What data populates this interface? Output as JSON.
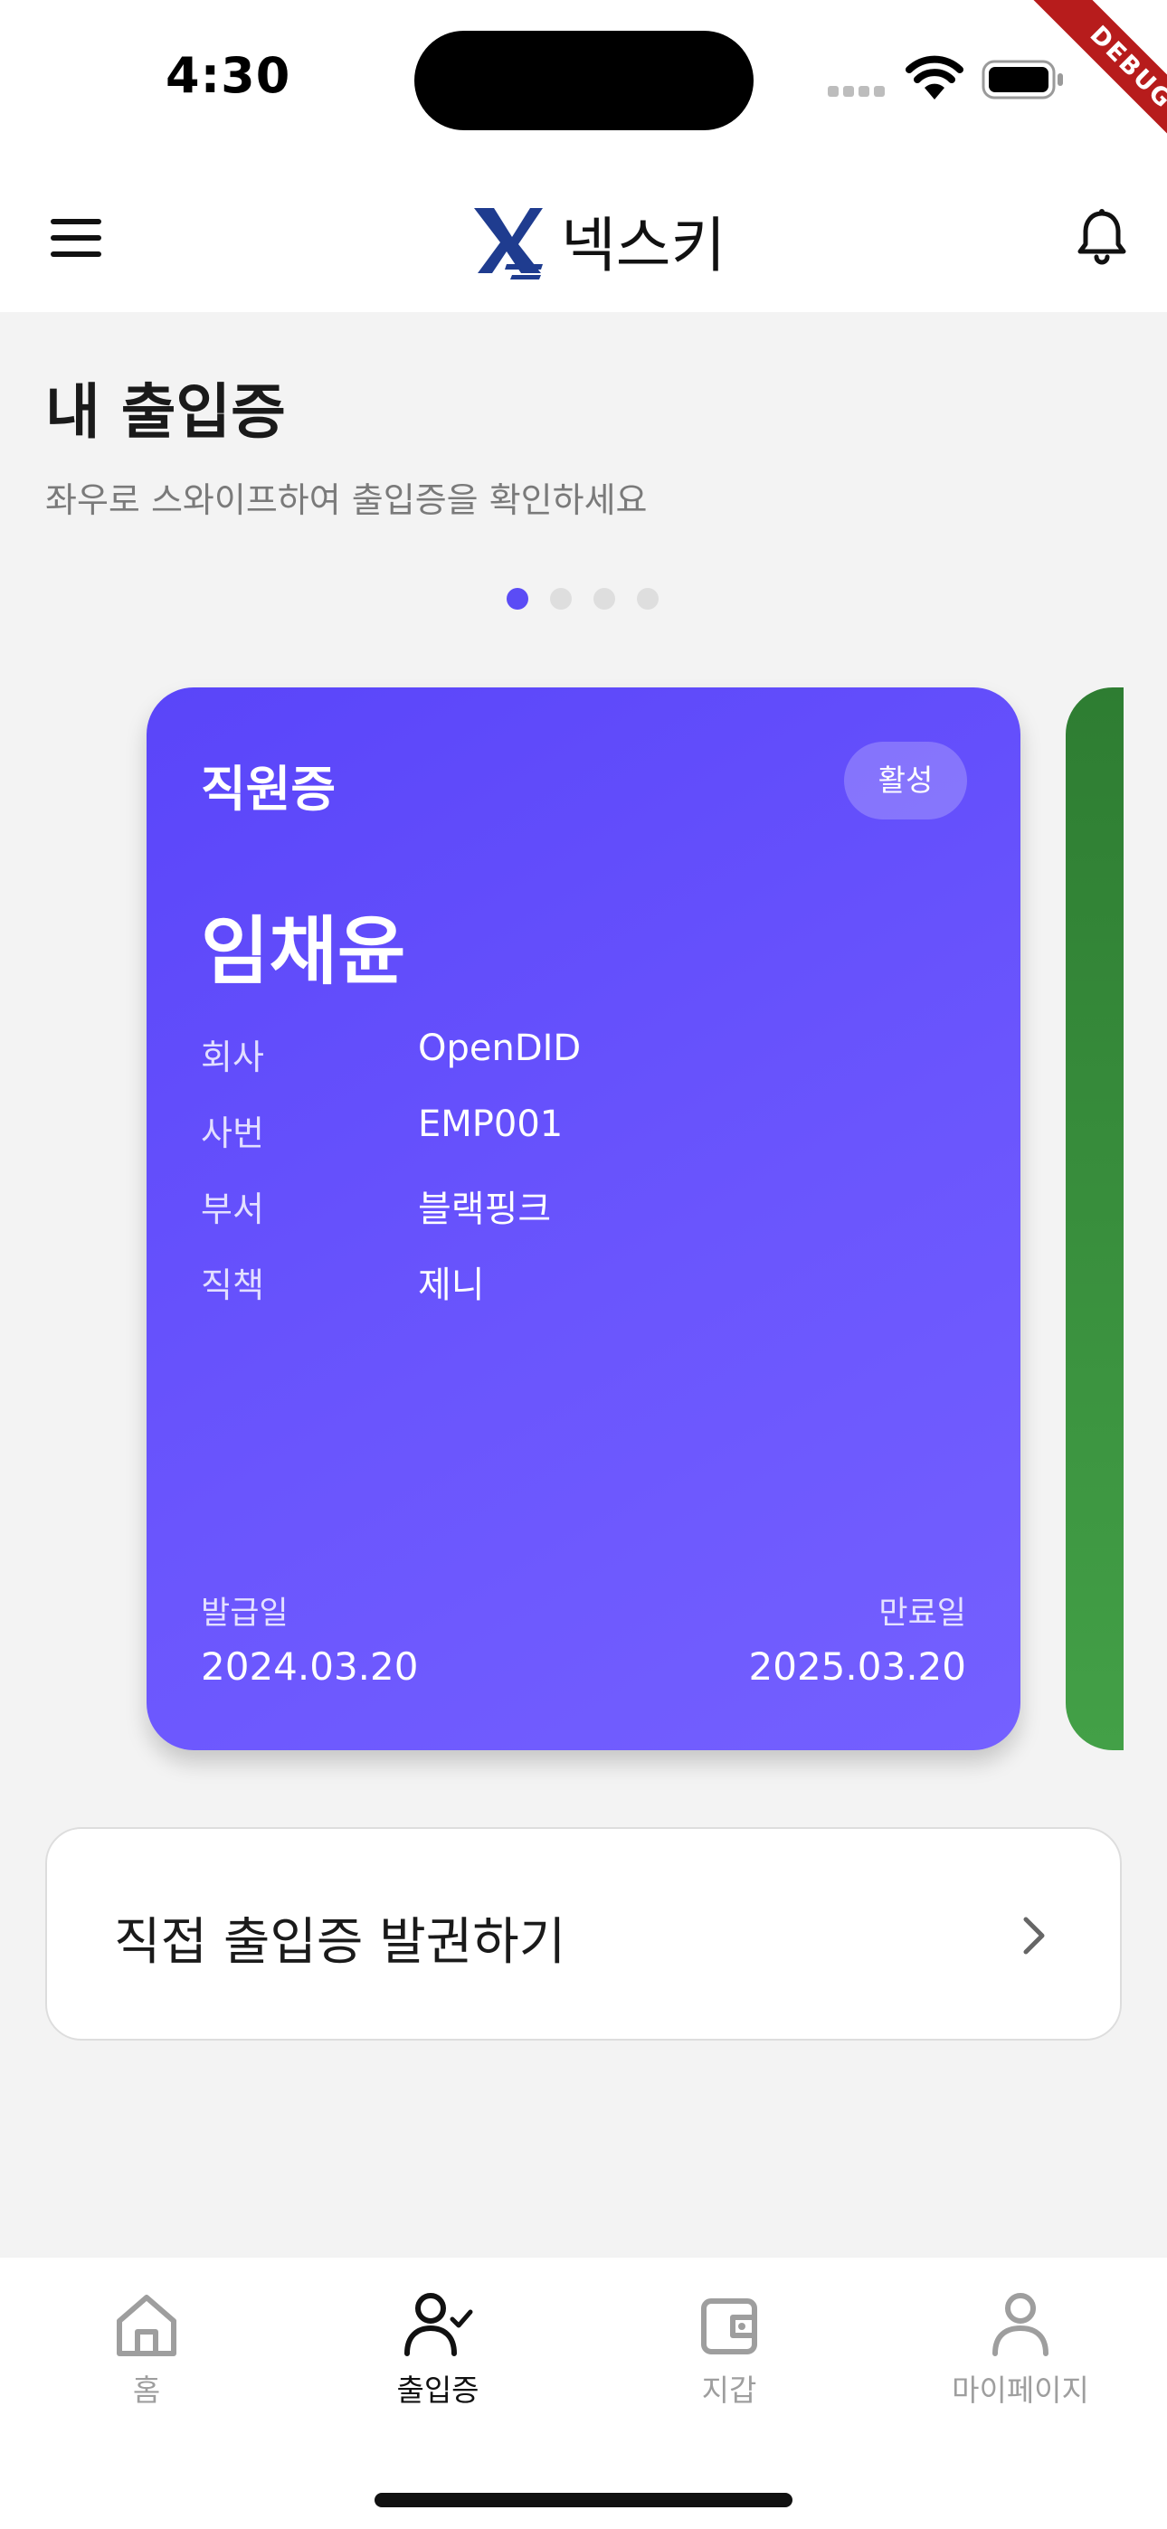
{
  "status_bar": {
    "time": "4:30",
    "debug_label": "DEBUG"
  },
  "app_bar": {
    "title": "넥스키",
    "menu_icon": "hamburger-menu-icon",
    "notification_icon": "bell-icon"
  },
  "page": {
    "title": "내 출입증",
    "subtitle": "좌우로 스와이프하여 출입증을 확인하세요"
  },
  "pager": {
    "total": 4,
    "active_index": 0,
    "active_color": "#5b4cf5",
    "inactive_color": "#dedede"
  },
  "card": {
    "type": "직원증",
    "badge": "활성",
    "name": "임채윤",
    "rows": [
      {
        "label": "회사",
        "value": "OpenDID"
      },
      {
        "label": "사번",
        "value": "EMP001"
      },
      {
        "label": "부서",
        "value": "블랙핑크"
      },
      {
        "label": "직책",
        "value": "제니"
      }
    ],
    "issue_date_label": "발급일",
    "issue_date": "2024.03.20",
    "expiry_date_label": "만료일",
    "expiry_date": "2025.03.20",
    "color": "#5e49fa"
  },
  "next_card": {
    "color": "#388e3c"
  },
  "issue_button": {
    "label": "직접 출입증 발권하기",
    "icon": "chevron-right-icon"
  },
  "bottom_nav": {
    "items": [
      {
        "label": "홈",
        "icon": "home-icon",
        "active": false
      },
      {
        "label": "출입증",
        "icon": "user-check-icon",
        "active": true
      },
      {
        "label": "지갑",
        "icon": "wallet-icon",
        "active": false
      },
      {
        "label": "마이페이지",
        "icon": "person-icon",
        "active": false
      }
    ]
  }
}
